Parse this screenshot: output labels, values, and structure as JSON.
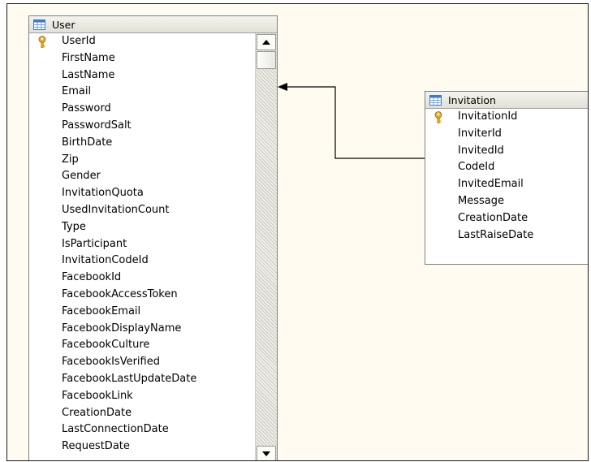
{
  "user_table": {
    "title": "User",
    "primary_key": "UserId",
    "columns": [
      "UserId",
      "FirstName",
      "LastName",
      "Email",
      "Password",
      "PasswordSalt",
      "BirthDate",
      "Zip",
      "Gender",
      "InvitationQuota",
      "UsedInvitationCount",
      "Type",
      "IsParticipant",
      "InvitationCodeId",
      "FacebookId",
      "FacebookAccessToken",
      "FacebookEmail",
      "FacebookDisplayName",
      "FacebookCulture",
      "FacebookIsVerified",
      "FacebookLastUpdateDate",
      "FacebookLink",
      "CreationDate",
      "LastConnectionDate",
      "RequestDate"
    ]
  },
  "invitation_table": {
    "title": "Invitation",
    "primary_key": "InvitationId",
    "columns": [
      "InvitationId",
      "InviterId",
      "InvitedId",
      "CodeId",
      "InvitedEmail",
      "Message",
      "CreationDate",
      "LastRaiseDate"
    ]
  },
  "colors": {
    "canvas_background": "#fffbf0",
    "key_icon": "#e8b020",
    "table_icon": "#3a78c8"
  },
  "icons": {
    "table": "table-grid-icon",
    "primary_key": "key-icon",
    "scroll_up": "arrow-up-icon",
    "scroll_down": "arrow-down-icon",
    "relationship": "relationship-arrow-icon"
  }
}
